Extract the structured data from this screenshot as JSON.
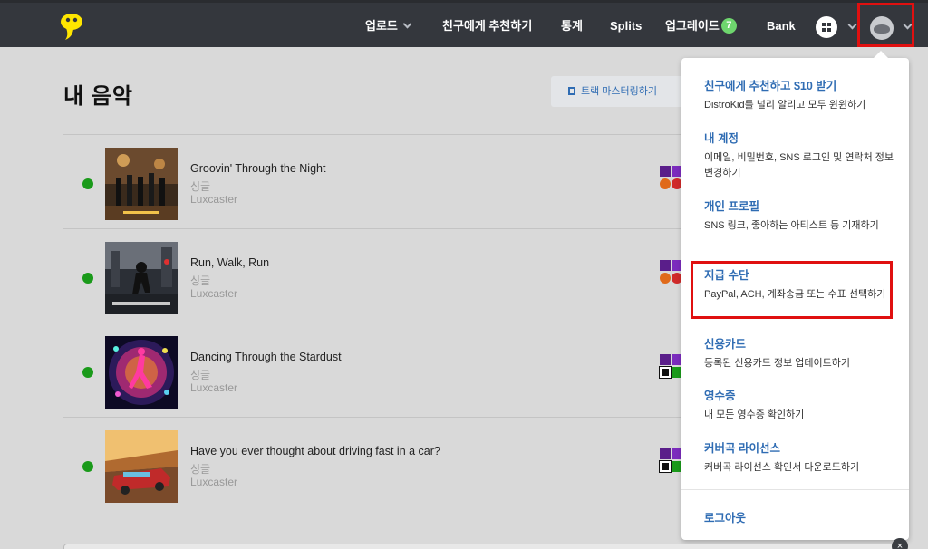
{
  "nav": {
    "upload": "업로드",
    "refer": "친구에게 추천하기",
    "stats": "통계",
    "splits": "Splits",
    "upgrade": "업그레이드",
    "upgrade_count": "7",
    "bank": "Bank"
  },
  "page": {
    "title": "내 음악",
    "master_button": "트랙 마스터링하기"
  },
  "tracks": [
    {
      "title": "Groovin' Through the Night",
      "type": "싱글",
      "artist": "Luxcaster"
    },
    {
      "title": "Run, Walk, Run",
      "type": "싱글",
      "artist": "Luxcaster"
    },
    {
      "title": "Dancing Through the Stardust",
      "type": "싱글",
      "artist": "Luxcaster"
    },
    {
      "title": "Have you ever thought about driving fast in a car?",
      "type": "싱글",
      "artist": "Luxcaster"
    }
  ],
  "menu": {
    "items": [
      {
        "title": "친구에게 추천하고 $10 받기",
        "desc": "DistroKid를 널리 알리고 모두 윈윈하기"
      },
      {
        "title": "내 계정",
        "desc": "이메일, 비밀번호, SNS 로그인 및 연락처 정보 변경하기"
      },
      {
        "title": "개인 프로필",
        "desc": "SNS 링크, 좋아하는 아티스트 등 기재하기"
      },
      {
        "title": "지급 수단",
        "desc": "PayPal, ACH, 계좌송금 또는 수표 선택하기"
      },
      {
        "title": "신용카드",
        "desc": "등록된 신용카드 정보 업데이트하기"
      },
      {
        "title": "영수증",
        "desc": "내 모든 영수증 확인하기"
      },
      {
        "title": "커버곡 라이선스",
        "desc": "커버곡 라이선스 확인서 다운로드하기"
      }
    ],
    "logout": "로그아웃"
  },
  "colors": {
    "nav_bg": "#34373d",
    "link_blue": "#2f6cb3",
    "status_green": "#1a9a1a",
    "highlight_red": "#e01010",
    "badge_green": "#6ed66e"
  },
  "close_symbol": "×"
}
